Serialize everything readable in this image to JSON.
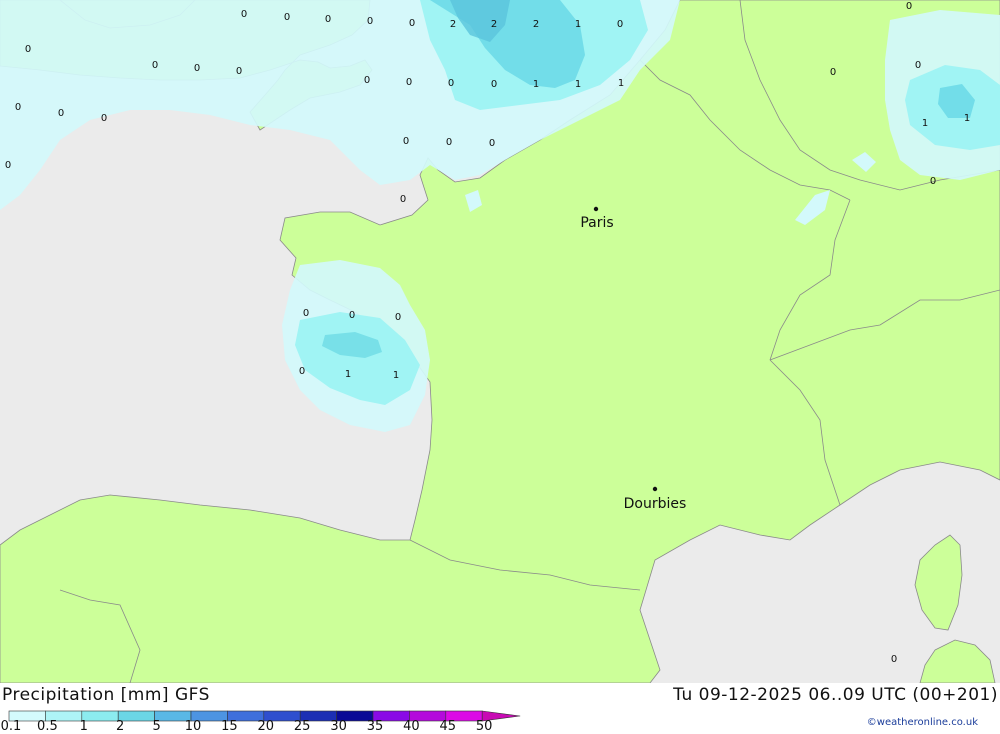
{
  "title": "Precipitation [mm] GFS",
  "valid_time": "Tu 09-12-2025 06..09 UTC (00+201)",
  "credit": "©weatheronline.co.uk",
  "colors": {
    "sea": "#ebebeb",
    "land": "#ccff99",
    "border": "#8a8a8a",
    "precip_light": "#d3f9fb",
    "precip_mid": "#a0f4f4",
    "precip_heavy": "#6ad8e6"
  },
  "cities": [
    {
      "name": "Paris"
    },
    {
      "name": "Dourbies"
    }
  ],
  "grid_values": [
    "0",
    "0",
    "0",
    "0",
    "0",
    "2",
    "2",
    "2",
    "1",
    "0",
    "0",
    "0",
    "0",
    "0",
    "0",
    "0",
    "0",
    "0",
    "0",
    "1",
    "1",
    "1",
    "0",
    "0",
    "0",
    "1",
    "1",
    "0",
    "0",
    "0",
    "0",
    "0",
    "0",
    "0",
    "0",
    "0",
    "0",
    "0",
    "0",
    "0",
    "1",
    "1",
    "0"
  ],
  "legend": {
    "ticks": [
      "0.1",
      "0.5",
      "1",
      "2",
      "5",
      "10",
      "15",
      "20",
      "25",
      "30",
      "35",
      "40",
      "45",
      "50"
    ],
    "colors": [
      "#d4fafd",
      "#aef4f6",
      "#8cecef",
      "#6bd6e6",
      "#5ab8e6",
      "#4d94e2",
      "#3e6fdc",
      "#2f4fce",
      "#1c2fb4",
      "#0a0a96",
      "#8a0ae6",
      "#b40adc",
      "#dc0ae6",
      "#c80ab4"
    ]
  }
}
